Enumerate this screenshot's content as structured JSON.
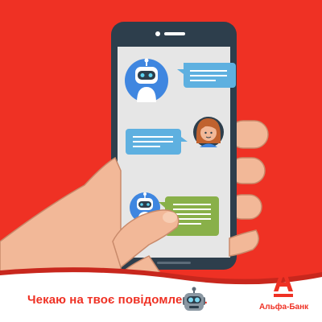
{
  "banner": {
    "caption": "Чекаю на твоє повідомлення.",
    "brand_name": "Альфа-Банк"
  },
  "icons": {
    "caption_emoji": "robot-face-icon",
    "brand_mark": "alfa-bank-logo-icon"
  },
  "chat": {
    "messages": [
      {
        "sender": "bot",
        "bubble": "blue",
        "side": "right",
        "lines": 3
      },
      {
        "sender": "user",
        "bubble": "blue",
        "side": "left",
        "lines": 3
      },
      {
        "sender": "bot",
        "bubble": "green",
        "side": "right",
        "lines": 5
      }
    ]
  },
  "colors": {
    "background": "#ef3124",
    "accent_red": "#ef3124",
    "phone_body": "#2d3e4c",
    "screen": "#e6e6e6",
    "bubble_blue": "#5eb0e0",
    "bubble_green": "#89b049",
    "skin": "#f2b898",
    "bottom_band": "#ffffff"
  }
}
